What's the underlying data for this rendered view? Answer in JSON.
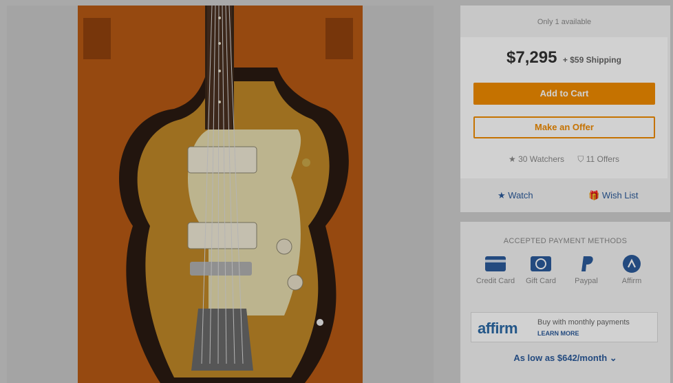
{
  "listing": {
    "availability": "Only 1 available",
    "price": "$7,295",
    "shipping": "+ $59 Shipping",
    "add_to_cart": "Add to Cart",
    "make_offer": "Make an Offer",
    "watchers": "30 Watchers",
    "offers": "11 Offers",
    "watch_label": "Watch",
    "wishlist_label": "Wish List"
  },
  "payments": {
    "title": "ACCEPTED PAYMENT METHODS",
    "methods": [
      {
        "label": "Credit Card",
        "icon": "credit-card-icon"
      },
      {
        "label": "Gift Card",
        "icon": "gift-card-icon"
      },
      {
        "label": "Paypal",
        "icon": "paypal-icon"
      },
      {
        "label": "Affirm",
        "icon": "affirm-icon"
      }
    ],
    "affirm_logo": "affirm",
    "affirm_text": "Buy with monthly payments",
    "affirm_learn": "LEARN MORE",
    "as_low": "As low as $642/month"
  },
  "colors": {
    "accent_orange": "#f18b00",
    "link_blue": "#2b5b9b",
    "affirm_blue": "#2b6aa6"
  }
}
